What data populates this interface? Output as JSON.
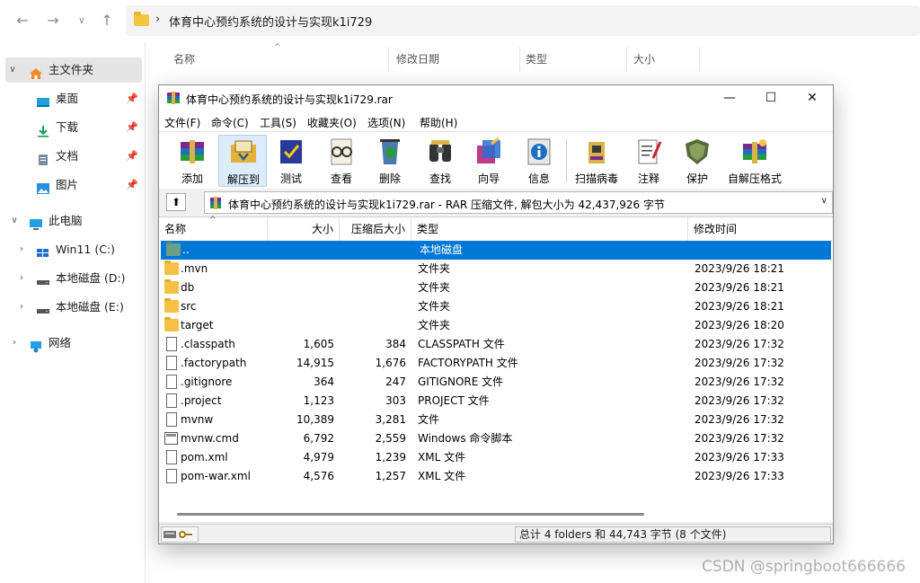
{
  "explorer": {
    "path": "体育中心预约系统的设计与实现k1i729",
    "sidebar": [
      {
        "label": "主文件夹",
        "icon": "home-icon",
        "selected": true
      },
      {
        "label": "桌面",
        "icon": "desktop-icon",
        "pinned": true
      },
      {
        "label": "下载",
        "icon": "download-icon",
        "pinned": true
      },
      {
        "label": "文档",
        "icon": "document-icon",
        "pinned": true
      },
      {
        "label": "图片",
        "icon": "pictures-icon",
        "pinned": true
      },
      {
        "label": "此电脑",
        "icon": "computer-icon"
      },
      {
        "label": "Win11 (C:)",
        "icon": "drive-icon"
      },
      {
        "label": "本地磁盘 (D:)",
        "icon": "drive-icon"
      },
      {
        "label": "本地磁盘 (E:)",
        "icon": "drive-icon"
      },
      {
        "label": "网络",
        "icon": "network-icon"
      }
    ],
    "columns": [
      "名称",
      "修改日期",
      "类型",
      "大小"
    ]
  },
  "winrar": {
    "title": "体育中心预约系统的设计与实现k1i729.rar",
    "menu": [
      "文件(F)",
      "命令(C)",
      "工具(S)",
      "收藏夹(O)",
      "选项(N)",
      "帮助(H)"
    ],
    "toolbar": [
      "添加",
      "解压到",
      "测试",
      "查看",
      "删除",
      "查找",
      "向导",
      "信息",
      "扫描病毒",
      "注释",
      "保护",
      "自解压格式"
    ],
    "path_text": "体育中心预约系统的设计与实现k1i729.rar - RAR 压缩文件, 解包大小为 42,437,926 字节",
    "columns": [
      "名称",
      "大小",
      "压缩后大小",
      "类型",
      "修改时间"
    ],
    "rows": [
      {
        "name": "..",
        "size": "",
        "packed": "",
        "type": "本地磁盘",
        "modified": "",
        "kind": "up"
      },
      {
        "name": ".mvn",
        "size": "",
        "packed": "",
        "type": "文件夹",
        "modified": "2023/9/26 18:21",
        "kind": "folder"
      },
      {
        "name": "db",
        "size": "",
        "packed": "",
        "type": "文件夹",
        "modified": "2023/9/26 18:21",
        "kind": "folder"
      },
      {
        "name": "src",
        "size": "",
        "packed": "",
        "type": "文件夹",
        "modified": "2023/9/26 18:21",
        "kind": "folder"
      },
      {
        "name": "target",
        "size": "",
        "packed": "",
        "type": "文件夹",
        "modified": "2023/9/26 18:20",
        "kind": "folder"
      },
      {
        "name": ".classpath",
        "size": "1,605",
        "packed": "384",
        "type": "CLASSPATH 文件",
        "modified": "2023/9/26 17:32",
        "kind": "file"
      },
      {
        "name": ".factorypath",
        "size": "14,915",
        "packed": "1,676",
        "type": "FACTORYPATH 文件",
        "modified": "2023/9/26 17:32",
        "kind": "file"
      },
      {
        "name": ".gitignore",
        "size": "364",
        "packed": "247",
        "type": "GITIGNORE 文件",
        "modified": "2023/9/26 17:32",
        "kind": "file"
      },
      {
        "name": ".project",
        "size": "1,123",
        "packed": "303",
        "type": "PROJECT 文件",
        "modified": "2023/9/26 17:32",
        "kind": "file"
      },
      {
        "name": "mvnw",
        "size": "10,389",
        "packed": "3,281",
        "type": "文件",
        "modified": "2023/9/26 17:32",
        "kind": "file"
      },
      {
        "name": "mvnw.cmd",
        "size": "6,792",
        "packed": "2,559",
        "type": "Windows 命令脚本",
        "modified": "2023/9/26 17:32",
        "kind": "cmd"
      },
      {
        "name": "pom.xml",
        "size": "4,979",
        "packed": "1,239",
        "type": "XML 文件",
        "modified": "2023/9/26 17:33",
        "kind": "file"
      },
      {
        "name": "pom-war.xml",
        "size": "4,576",
        "packed": "1,257",
        "type": "XML 文件",
        "modified": "2023/9/26 17:33",
        "kind": "file"
      }
    ],
    "status": "总计 4 folders 和 44,743 字节 (8 个文件)"
  },
  "watermark": "CSDN @springboot666666",
  "colors": {
    "selection": "#0078d7",
    "folder": "#f6c142"
  }
}
